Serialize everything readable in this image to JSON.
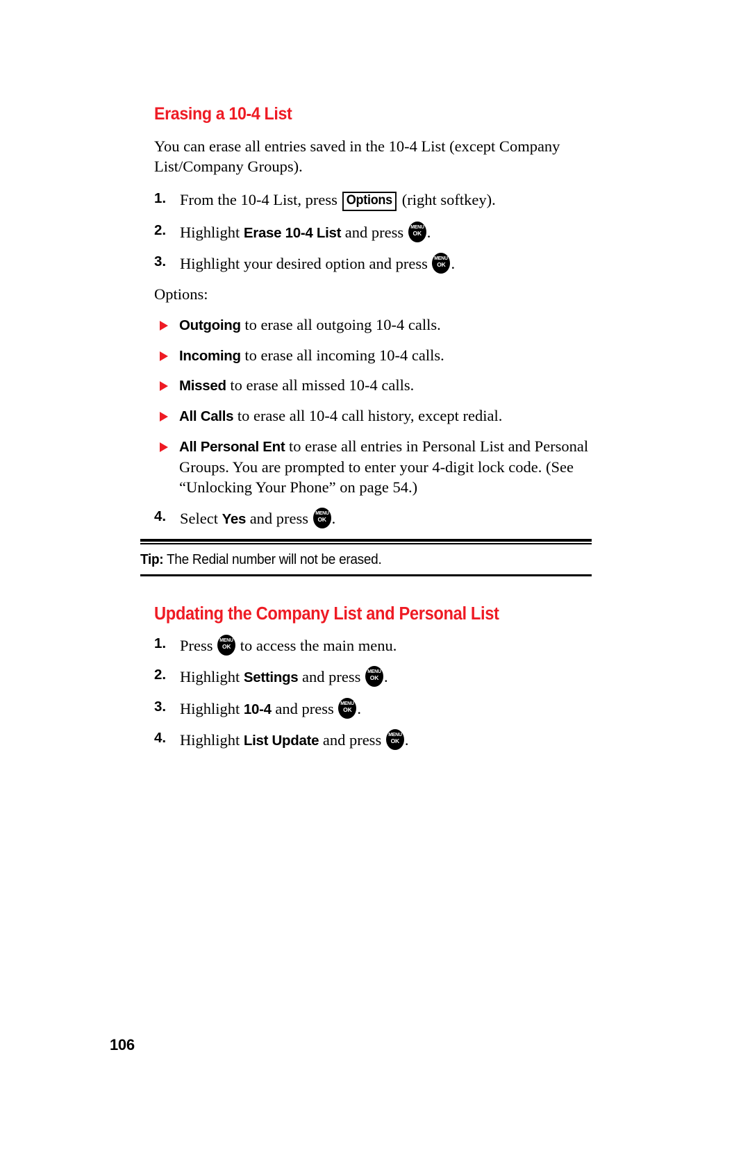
{
  "page": {
    "number": "106",
    "accent_color": "#ee1b24"
  },
  "section1": {
    "heading": "Erasing a 10-4 List",
    "intro": "You can erase all entries saved in the 10-4 List (except Company List/Company Groups).",
    "steps": [
      {
        "num": "1.",
        "pre": "From the 10-4 List, press ",
        "softkey": "Options",
        "post": " (right softkey)."
      },
      {
        "num": "2.",
        "pre": "Highlight ",
        "bold": "Erase 10-4 List",
        "mid": " and press ",
        "post": "."
      },
      {
        "num": "3.",
        "pre": "Highlight your desired option and press ",
        "post": "."
      }
    ],
    "options_label": "Options:",
    "options": [
      {
        "bold": "Outgoing",
        "text": " to erase all outgoing 10-4 calls."
      },
      {
        "bold": "Incoming",
        "text": " to erase all incoming 10-4 calls."
      },
      {
        "bold": "Missed",
        "text": " to erase all missed 10-4 calls."
      },
      {
        "bold": "All Calls",
        "text": " to erase all 10-4 call history, except redial."
      },
      {
        "bold": "All Personal Ent",
        "text": " to erase all entries in Personal List and Personal Groups. You are prompted to enter your 4-digit lock code. (See “Unlocking Your Phone” on page 54.)"
      }
    ],
    "final_step": {
      "num": "4.",
      "pre": "Select ",
      "bold": "Yes",
      "mid": " and press ",
      "post": "."
    },
    "tip": {
      "label": "Tip:",
      "text": " The Redial number will not be erased."
    }
  },
  "section2": {
    "heading": "Updating the Company List and Personal List",
    "steps": [
      {
        "num": "1.",
        "pre": "Press ",
        "mid": " to access the main menu.",
        "post": ""
      },
      {
        "num": "2.",
        "pre": "Highlight ",
        "bold": "Settings",
        "mid": " and press ",
        "post": "."
      },
      {
        "num": "3.",
        "pre": "Highlight ",
        "bold": "10-4",
        "mid": " and press ",
        "post": "."
      },
      {
        "num": "4.",
        "pre": "Highlight ",
        "bold": "List Update",
        "mid": " and press ",
        "post": "."
      }
    ]
  },
  "icons": {
    "menu_key_top": "MENU",
    "menu_key_bottom": "OK",
    "bullet": "triangle-right"
  }
}
